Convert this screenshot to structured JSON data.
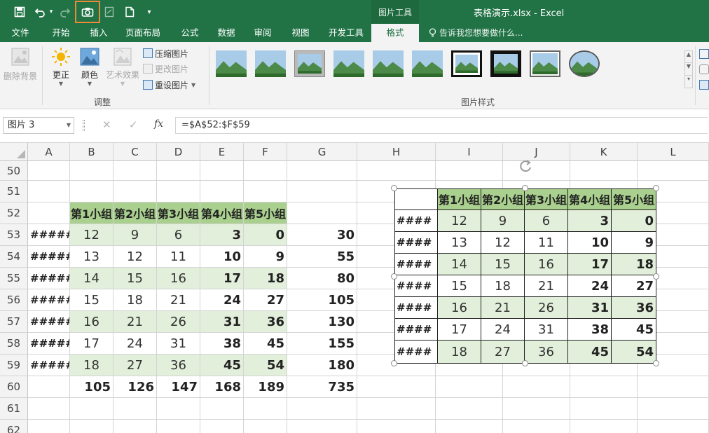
{
  "title_bar": {
    "window_title": "表格演示.xlsx - Excel",
    "context_tool": "图片工具",
    "qat_icons": [
      "save-icon",
      "undo-icon",
      "undo-dropdown-icon",
      "redo-icon",
      "camera-icon",
      "link-picture-icon",
      "new-file-icon",
      "customize-qat-icon"
    ]
  },
  "tabs": [
    "文件",
    "开始",
    "插入",
    "页面布局",
    "公式",
    "数据",
    "审阅",
    "视图",
    "开发工具",
    "格式"
  ],
  "active_tab": "格式",
  "tell_me": "告诉我您想要做什么...",
  "ribbon": {
    "remove_background": "删除背景",
    "corrections": "更正",
    "color": "颜色",
    "artistic_effects": "艺术效果",
    "compress": "压缩图片",
    "change_picture": "更改图片",
    "reset_picture": "重设图片",
    "group_adjust": "调整",
    "group_styles": "图片样式",
    "style_count": 10
  },
  "formula_bar": {
    "name_box": "图片 3",
    "formula": "=$A$52:$F$59",
    "cancel": "✕",
    "enter": "✓",
    "fx": "fx"
  },
  "columns": [
    "A",
    "B",
    "C",
    "D",
    "E",
    "F",
    "G",
    "H",
    "I",
    "J",
    "K",
    "L"
  ],
  "rows": [
    "50",
    "51",
    "52",
    "53",
    "54",
    "55",
    "56",
    "57",
    "58",
    "59",
    "60",
    "61",
    "62"
  ],
  "sheet": {
    "headers": [
      "第1小组",
      "第2小组",
      "第3小组",
      "第4小组",
      "第5小组"
    ],
    "row_label": "#####",
    "data": [
      [
        12,
        9,
        6,
        3,
        0,
        30
      ],
      [
        13,
        12,
        11,
        10,
        9,
        55
      ],
      [
        14,
        15,
        16,
        17,
        18,
        80
      ],
      [
        15,
        18,
        21,
        24,
        27,
        105
      ],
      [
        16,
        21,
        26,
        31,
        36,
        130
      ],
      [
        17,
        24,
        31,
        38,
        45,
        155
      ],
      [
        18,
        27,
        36,
        45,
        54,
        180
      ]
    ],
    "totals": [
      105,
      126,
      147,
      168,
      189,
      735
    ]
  },
  "picture": {
    "row_label": "####"
  },
  "colors": {
    "excel_green": "#217346",
    "header_green": "#a9d08e",
    "band_green": "#e2efda",
    "highlight_orange": "#f0883a"
  }
}
